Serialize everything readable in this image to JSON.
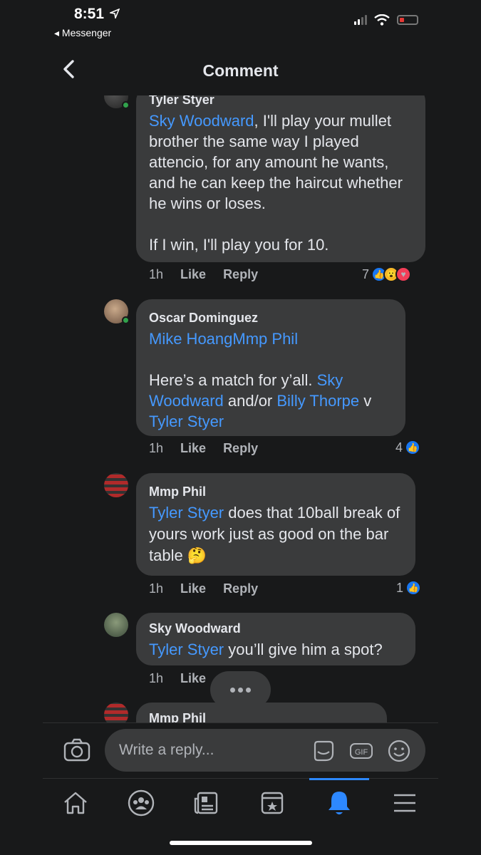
{
  "status": {
    "time": "8:51",
    "back_app": "Messenger"
  },
  "header": {
    "title": "Comment"
  },
  "comments": [
    {
      "author": "Tyler Styer",
      "mention": "Sky Woodward",
      "text_1": ", I'll play your mullet brother the same way I played attencio, for any amount he wants, and he can keep the haircut whether he wins or loses.",
      "text_2": "If I win, I'll play you for 10.",
      "time": "1h",
      "like": "Like",
      "reply": "Reply",
      "reaction_count": "7"
    },
    {
      "author": "Oscar Dominguez",
      "mention_line": "Mike HoangMmp Phil",
      "text_1": "Here’s a match for y’all. ",
      "mention_2": "Sky Woodward",
      "text_2": " and/or ",
      "mention_3": "Billy Thorpe",
      "text_3": " v ",
      "mention_4": "Tyler Styer",
      "time": "1h",
      "like": "Like",
      "reply": "Reply",
      "reaction_count": "4"
    },
    {
      "author": "Mmp Phil",
      "mention": "Tyler Styer",
      "text_1": " does that 10ball break of yours work just as good on the bar table ",
      "emoji": "🤔",
      "time": "1h",
      "like": "Like",
      "reply": "Reply",
      "reaction_count": "1"
    },
    {
      "author": "Sky Woodward",
      "mention": "Tyler Styer",
      "text_1": " you’ll give him a spot?",
      "time": "1h",
      "like": "Like"
    },
    {
      "author": "Mmp Phil"
    }
  ],
  "composer": {
    "placeholder": "Write a reply...",
    "gif_label": "GIF"
  },
  "colors": {
    "accent": "#4599ff",
    "like": "#1877f2",
    "love": "#f33e58",
    "wow": "#f7b928",
    "bubble": "#3a3b3c",
    "background": "#18191a"
  },
  "tabs": [
    "home-icon",
    "groups-icon",
    "news-icon",
    "marketplace-icon",
    "notifications-icon",
    "menu-icon"
  ],
  "active_tab": "notifications-icon"
}
